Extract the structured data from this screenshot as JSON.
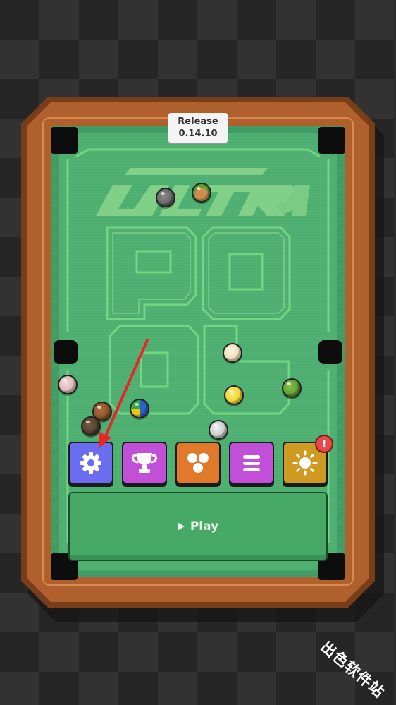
{
  "badge": {
    "line1": "Release",
    "line2": "0.14.10"
  },
  "play": {
    "label": "Play"
  },
  "menu": [
    {
      "name": "settings",
      "icon": "gear-icon",
      "color": "#6b6cf0"
    },
    {
      "name": "trophy",
      "icon": "trophy-icon",
      "color": "#c14fd8"
    },
    {
      "name": "balls",
      "icon": "balls-icon",
      "color": "#e07a2a"
    },
    {
      "name": "list",
      "icon": "list-icon",
      "color": "#c14fd8"
    },
    {
      "name": "theme",
      "icon": "sun-icon",
      "color": "#cf9a21"
    }
  ],
  "notification": {
    "mark": "!"
  },
  "annotation": {
    "arrow_color": "#e8262a"
  },
  "watermark": {
    "text": "出色软件站"
  }
}
